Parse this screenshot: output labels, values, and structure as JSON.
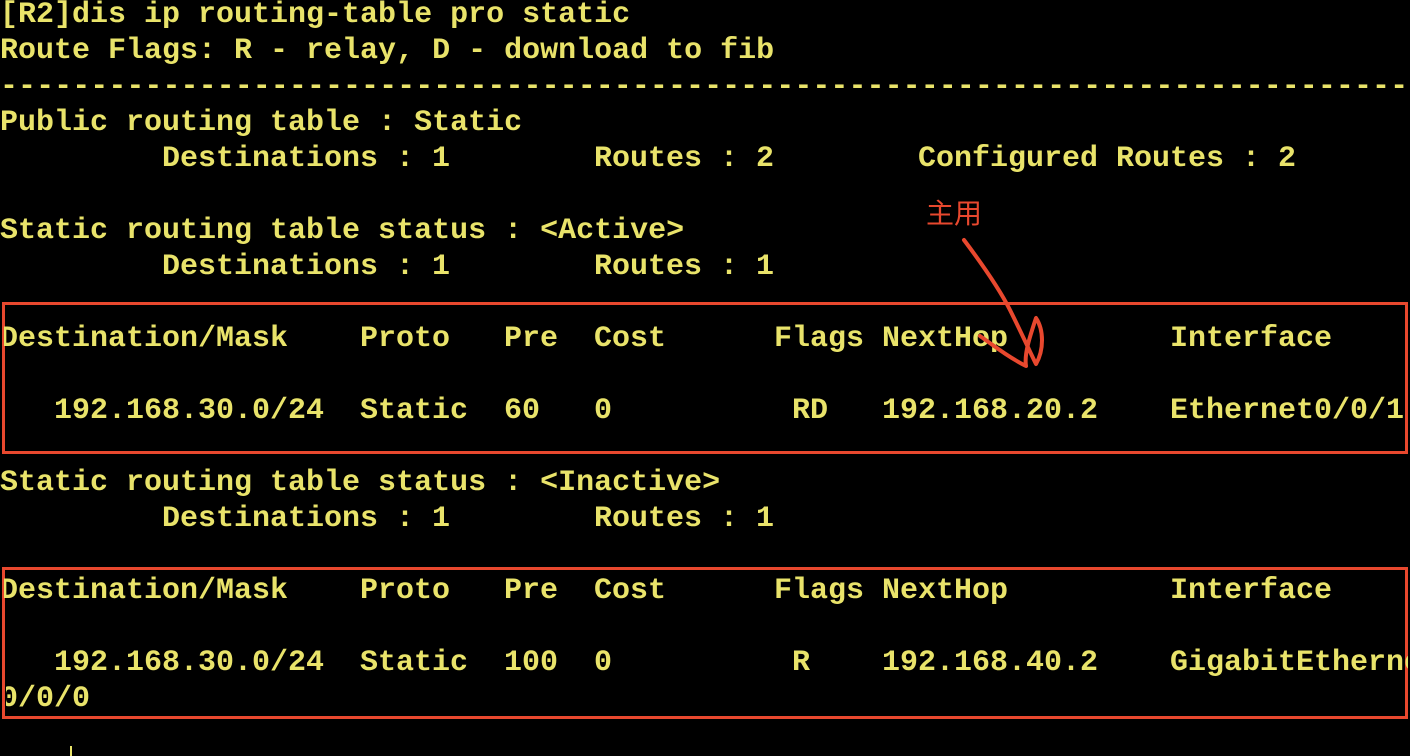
{
  "terminal": {
    "command": "[R2]dis ip routing-table pro static",
    "flags_legend": "Route Flags: R - relay, D - download to fib",
    "separator": "------------------------------------------------------------------------------",
    "public_table": {
      "title": "Public routing table : Static",
      "destinations_label": "Destinations : 1",
      "routes_label": "Routes : 2",
      "configured_label": "Configured Routes : 2"
    },
    "active_section": {
      "status_line": "Static routing table status : <Active>",
      "destinations_label": "Destinations : 1",
      "routes_label": "Routes : 1"
    },
    "inactive_section": {
      "status_line": "Static routing table status : <Inactive>",
      "destinations_label": "Destinations : 1",
      "routes_label": "Routes : 1"
    },
    "columns": {
      "destination": "Destination/Mask",
      "proto": "Proto",
      "pre": "Pre",
      "cost": "Cost",
      "flags": "Flags",
      "nexthop": "NextHop",
      "interface": "Interface"
    },
    "active_route": {
      "destination": "192.168.30.0/24",
      "proto": "Static",
      "pre": "60",
      "cost": "0",
      "flags": "RD",
      "nexthop": "192.168.20.2",
      "interface": "Ethernet0/0/1"
    },
    "inactive_route": {
      "destination": "192.168.30.0/24",
      "proto": "Static",
      "pre": "100",
      "cost": "0",
      "flags": "R",
      "nexthop": "192.168.40.2",
      "interface": "GigabitEtherne",
      "interface_wrap": "0/0/0"
    }
  },
  "annotation": {
    "label": "主用",
    "color": "#e8482e"
  },
  "colors": {
    "background": "#000000",
    "text": "#e9e36a",
    "highlight": "#e8482e"
  }
}
